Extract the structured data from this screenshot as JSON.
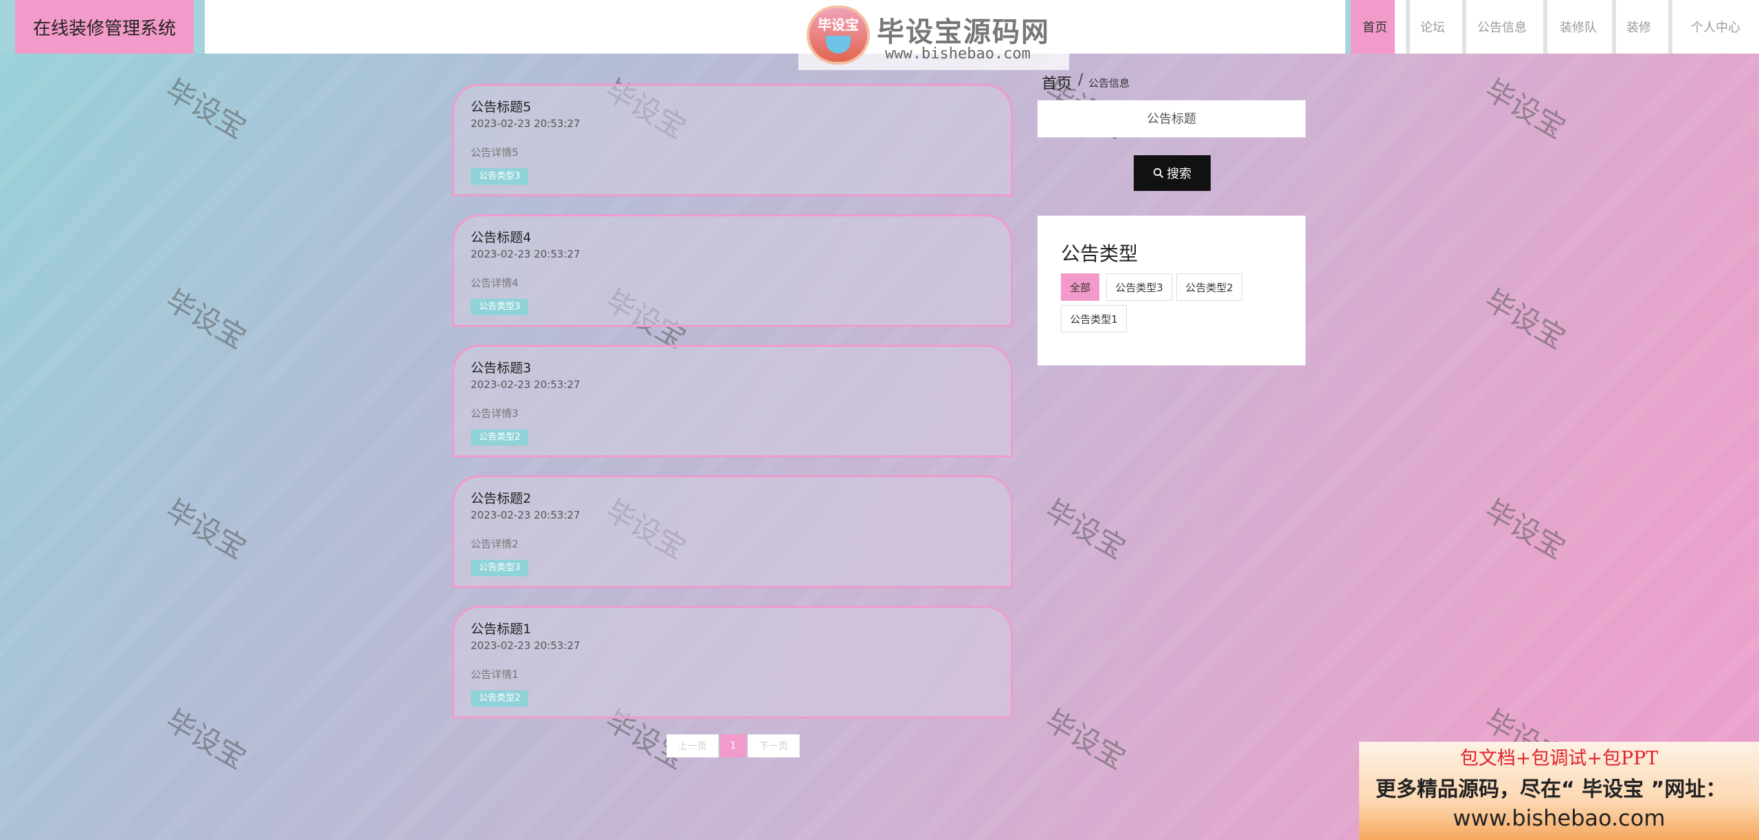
{
  "header": {
    "brand": "在线装修管理系统",
    "nav": [
      {
        "label": "首页",
        "active": true
      },
      {
        "label": "论坛",
        "active": false
      },
      {
        "label": "公告信息",
        "active": false
      },
      {
        "label": "装修队",
        "active": false
      },
      {
        "label": "装修",
        "active": false
      },
      {
        "label": "个人中心",
        "active": false
      }
    ]
  },
  "logo_watermark": {
    "badge": "毕设宝",
    "title": "毕设宝源码网",
    "url": "www.bishebao.com"
  },
  "watermark_text": "毕设宝",
  "notices": [
    {
      "title": "公告标题5",
      "time": "2023-02-23 20:53:27",
      "detail": "公告详情5",
      "type": "公告类型3"
    },
    {
      "title": "公告标题4",
      "time": "2023-02-23 20:53:27",
      "detail": "公告详情4",
      "type": "公告类型3"
    },
    {
      "title": "公告标题3",
      "time": "2023-02-23 20:53:27",
      "detail": "公告详情3",
      "type": "公告类型2"
    },
    {
      "title": "公告标题2",
      "time": "2023-02-23 20:53:27",
      "detail": "公告详情2",
      "type": "公告类型3"
    },
    {
      "title": "公告标题1",
      "time": "2023-02-23 20:53:27",
      "detail": "公告详情1",
      "type": "公告类型2"
    }
  ],
  "pagination": {
    "prev": "上一页",
    "current": "1",
    "next": "下一页"
  },
  "breadcrumb": {
    "home": "首页",
    "separator": "/",
    "current": "公告信息"
  },
  "search": {
    "placeholder": "公告标题",
    "button": "搜索"
  },
  "type_filter": {
    "title": "公告类型",
    "options": [
      {
        "label": "全部",
        "active": true
      },
      {
        "label": "公告类型3",
        "active": false
      },
      {
        "label": "公告类型2",
        "active": false
      },
      {
        "label": "公告类型1",
        "active": false
      }
    ]
  },
  "promo": {
    "line1": "包文档+包调试+包PPT",
    "line2": "更多精品源码，尽在“ 毕设宝 ”网址：",
    "line3": "www.bishebao.com"
  },
  "colors": {
    "accent_pink": "#f29ac9",
    "tag_teal": "#8fd3d8",
    "search_button": "#111111"
  }
}
